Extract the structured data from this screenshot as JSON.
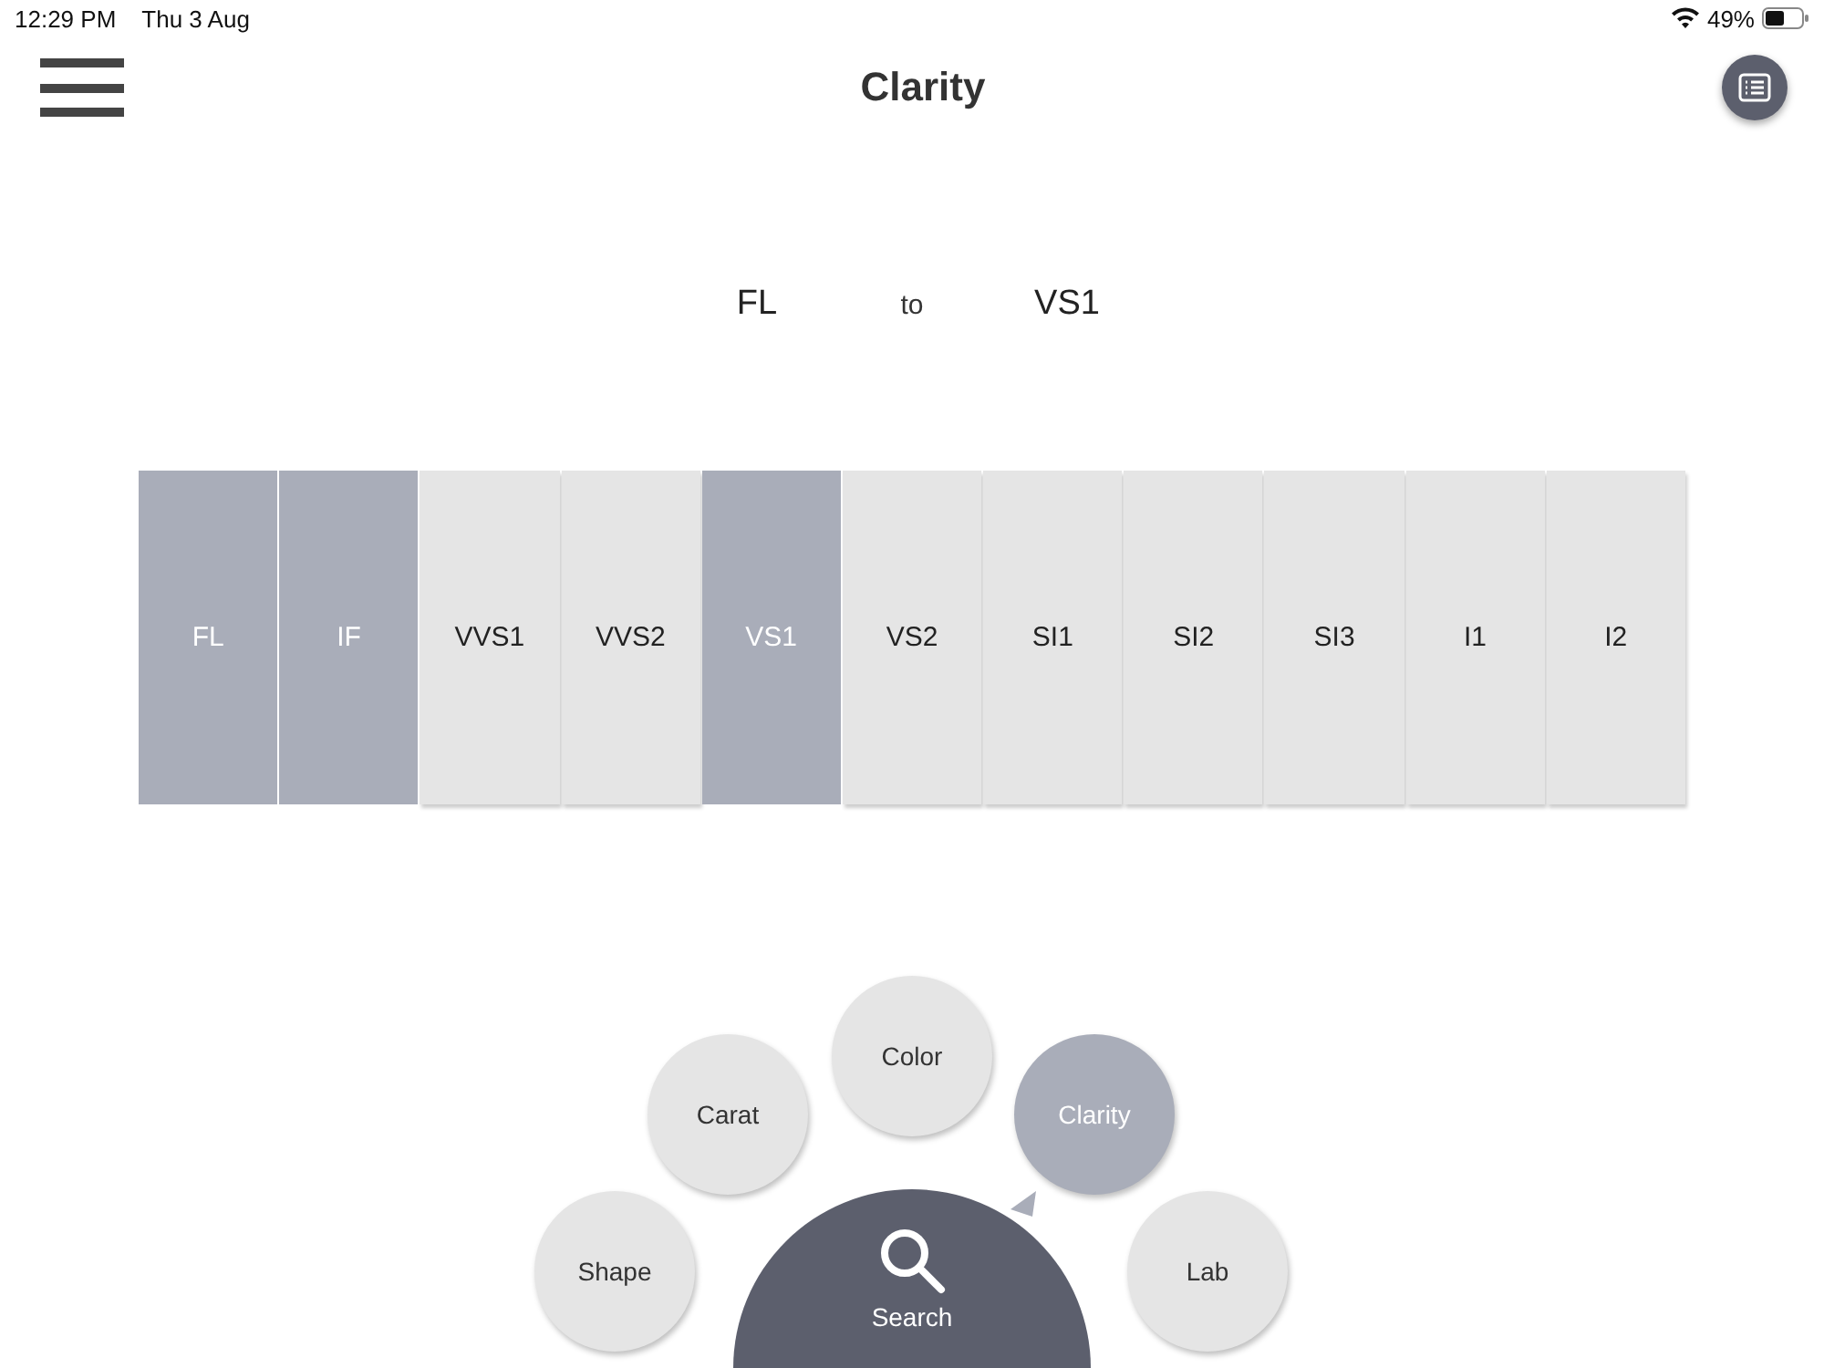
{
  "status_bar": {
    "time": "12:29 PM",
    "date": "Thu 3 Aug",
    "battery": "49%"
  },
  "header": {
    "title": "Clarity"
  },
  "range": {
    "from": "FL",
    "separator": "to",
    "to": "VS1"
  },
  "grades": [
    {
      "label": "FL",
      "selected": true
    },
    {
      "label": "IF",
      "selected": true
    },
    {
      "label": "VVS1",
      "selected": false
    },
    {
      "label": "VVS2",
      "selected": false
    },
    {
      "label": "VS1",
      "selected": true
    },
    {
      "label": "VS2",
      "selected": false
    },
    {
      "label": "SI1",
      "selected": false
    },
    {
      "label": "SI2",
      "selected": false
    },
    {
      "label": "SI3",
      "selected": false
    },
    {
      "label": "I1",
      "selected": false
    },
    {
      "label": "I2",
      "selected": false
    }
  ],
  "menu": {
    "items": [
      {
        "label": "Shape",
        "selected": false
      },
      {
        "label": "Carat",
        "selected": false
      },
      {
        "label": "Color",
        "selected": false
      },
      {
        "label": "Clarity",
        "selected": true
      },
      {
        "label": "Lab",
        "selected": false
      }
    ],
    "search": "Search"
  }
}
